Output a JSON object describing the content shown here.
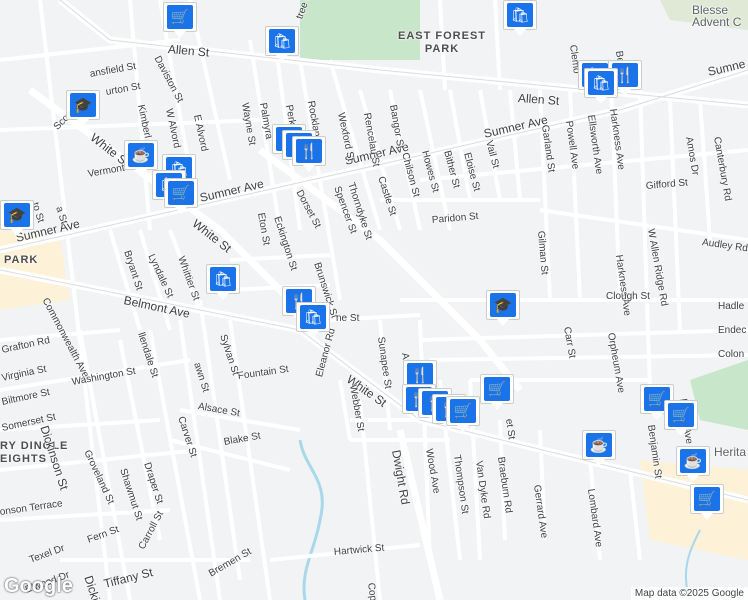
{
  "attribution": "Map data ©2025 Google",
  "logo": "Google",
  "areas": {
    "east_forest_park": "EAST FOREST\nPARK",
    "forest_park": "PARK",
    "dingle": "RY DINGLE\nEIGHTS",
    "blessed": "Blesse\nAdvent C",
    "heritage": "Herita"
  },
  "streets": {
    "allen_st_west": "Allen St",
    "allen_st_east": "Allen St",
    "sumner_ave_west": "Sumner Ave",
    "sumner_ave_mid": "Sumner Ave",
    "sumner_ave_east": "Sumner Ave",
    "sumner_ave_far": "Sumne",
    "white_st_nw": "White St",
    "white_st_mid": "White St",
    "white_st_se": "White St",
    "belmont_ave": "Belmont Ave",
    "dorset_st": "Dorset St",
    "brunswick_st": "Brunswick St",
    "eckington_st": "Eckington St",
    "eton_st": "Eton St",
    "wayne_st": "Wayne St",
    "palmyra": "Palmyra",
    "perkins": "Perkins",
    "rockland": "Rocklan",
    "wexford_st": "Wexford St",
    "rencelau_st": "Rencelau St",
    "bangor_st": "Bangor St",
    "castle_st": "Castle St",
    "chilson_st": "Chilson St",
    "thorndyke_st": "Thorndyke St",
    "spencer_st": "Spencer St",
    "howes_st": "Howes St",
    "bither_st": "Bither St",
    "eloise_st": "Eloise St",
    "vail_st": "Vail St",
    "garland_st": "Garland St",
    "powell_ave": "Powell Ave",
    "ellsworth_ave": "Ellsworth Ave",
    "harkness_ave": "Harkness Ave",
    "harkness_ave2": "Harkness Ave",
    "gifford_st": "Gifford St",
    "paridon_st": "Paridon St",
    "audley_rd": "Audley Rd",
    "gilman_st": "Gilman St",
    "w_allen_ridge_rd": "W Allen Ridge Rd",
    "amos_dr": "Amos Dr",
    "canterbury_rd": "Canterbury Rd",
    "clough_st": "Clough St",
    "hadley": "Hadle",
    "endecott": "Endec",
    "colonial": "Colon",
    "carr_st": "Carr St",
    "orpheum_ave": "Orpheum Ave",
    "sunapee_st": "Sunapee St",
    "dwight_rd": "Dwight Rd",
    "webber_st": "Webber St",
    "eleanor_rd": "Eleanor Rd",
    "wood_ave": "Wood Ave",
    "thompson_st": "Thompson St",
    "van_dyke_rd": "Van Dyke Rd",
    "braeburn_rd": "Braeburn Rd",
    "gerrard_ave": "Gerrard Ave",
    "lombard_ave": "Lombard Ave",
    "benjamin_st": "Benjamin St",
    "fountain_st": "Fountain St",
    "alsace_st": "Alsace St",
    "blake_st": "Blake St",
    "carver_st": "Carver St",
    "draper_st": "Draper St",
    "shawmut_st": "Shawmut St",
    "groveland_st": "Groveland St",
    "fern_st": "Fern St",
    "texel_dr": "Texel Dr",
    "elwood_dr": "Elwood Dr",
    "tiffany_st": "Tiffany St",
    "carroll_st": "Carroll St",
    "bremen_st": "Bremen St",
    "hartwick_st": "Hartwick St",
    "dickinson_st": "Dickinson St",
    "dickinson_st2": "Dickins",
    "commonwealth_ave": "Commonwealth Ave",
    "washington_st": "Washington St",
    "virginia_st": "Virginia St",
    "biltmore_st": "Biltmore St",
    "somerset_st": "Somerset St",
    "grafton_rd": "Grafton Rd",
    "bryant_st": "Bryant St",
    "lyndale_st": "Lyndale St",
    "whittier_st": "Whittier St",
    "sylvan_st": "Sylvan St",
    "ilendale_st": "llendale St",
    "lawn_st": "awn St",
    "kimberly": "Kimberl",
    "w_alvord": "W Alvord",
    "e_alvord": "E Alvord",
    "daviston_st": "Daviston St",
    "mansfield_st": "ansfield St",
    "scott_st": "Scott S",
    "burton_st": "urton St",
    "vermont_st": "Vermont St",
    "s_st": "S",
    "to_st": "to St",
    "a_st": "a St",
    "tree_rd": "tree Rd",
    "clemont": "Clemo",
    "be": "Be",
    "ne_st": "ne St",
    "au": "Au",
    "et_st": "et St",
    "cop": "Cop",
    "onson_terrace": "onson Terrace",
    "nn_st": "nn St",
    "ve_st": "Ve St",
    "ave_top": "Ave",
    "kness_ave": "kness Ave"
  },
  "pins": [
    {
      "type": "shopping-cart",
      "glyph": "🛒"
    },
    {
      "type": "shopping-bag",
      "glyph": "🛍"
    },
    {
      "type": "shopping-bag",
      "glyph": "🛍"
    },
    {
      "type": "school",
      "glyph": "🎓"
    },
    {
      "type": "restaurant",
      "glyph": "🍴"
    },
    {
      "type": "restaurant",
      "glyph": "🍴"
    },
    {
      "type": "restaurant",
      "glyph": "🍴"
    },
    {
      "type": "cafe",
      "glyph": "☕"
    },
    {
      "type": "shopping-bag",
      "glyph": "🛍"
    },
    {
      "type": "shopping-bag",
      "glyph": "🛍"
    },
    {
      "type": "shopping-cart",
      "glyph": "🛒"
    },
    {
      "type": "shopping-bag",
      "glyph": "🛍"
    },
    {
      "type": "restaurant",
      "glyph": "🍴"
    },
    {
      "type": "shopping-bag",
      "glyph": "🛍"
    },
    {
      "type": "school",
      "glyph": "🎓"
    },
    {
      "type": "school",
      "glyph": "🎓"
    },
    {
      "type": "restaurant",
      "glyph": "🍴"
    },
    {
      "type": "restaurant",
      "glyph": "🍴"
    },
    {
      "type": "restaurant",
      "glyph": "🍴"
    },
    {
      "type": "restaurant",
      "glyph": "🍴"
    },
    {
      "type": "shopping-bag",
      "glyph": "🛍"
    },
    {
      "type": "restaurant",
      "glyph": "🍴"
    },
    {
      "type": "shopping-cart",
      "glyph": "🛒"
    },
    {
      "type": "shopping-cart",
      "glyph": "🛒"
    },
    {
      "type": "shopping-cart",
      "glyph": "🛒"
    },
    {
      "type": "shopping-cart",
      "glyph": "🛒"
    },
    {
      "type": "cafe",
      "glyph": "☕"
    },
    {
      "type": "cafe",
      "glyph": "☕"
    },
    {
      "type": "shopping-cart",
      "glyph": "🛒"
    },
    {
      "type": "shopping-bag",
      "glyph": "🛍"
    }
  ],
  "colors": {
    "land": "#f1f3f4",
    "park": "#c8e6c9",
    "water": "#a8d8ea",
    "road": "#ffffff",
    "major": "#ffffff",
    "pin": "#1a73e8",
    "commercial": "#fdf2d7"
  }
}
